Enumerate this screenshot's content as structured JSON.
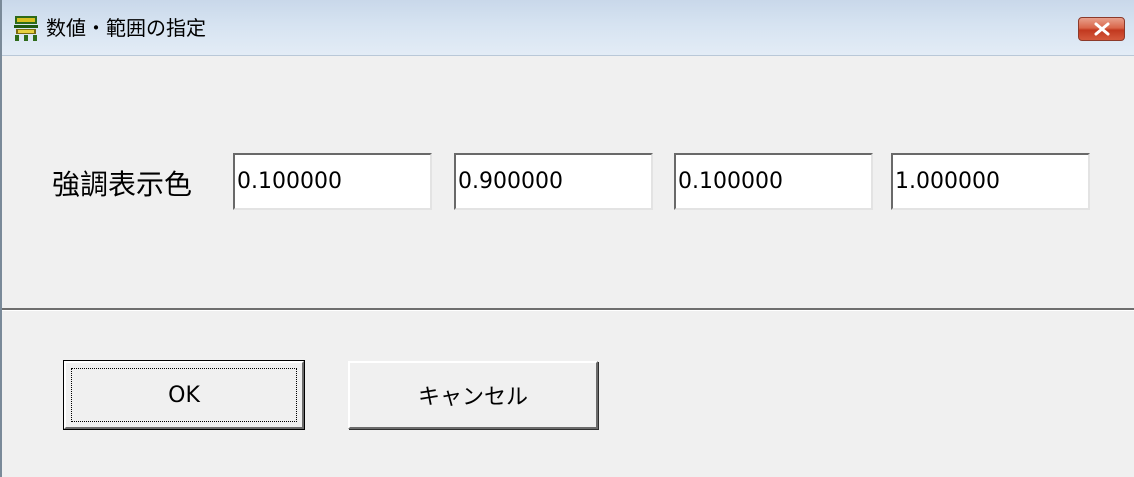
{
  "window": {
    "title": "数値・範囲の指定",
    "app_icon": "landscape-app-icon",
    "close_icon": "close-icon"
  },
  "form": {
    "label": "強調表示色",
    "fields": [
      "0.100000",
      "0.900000",
      "0.100000",
      "1.000000"
    ]
  },
  "buttons": {
    "ok_label": "OK",
    "cancel_label": "キャンセル"
  },
  "colors": {
    "close_button": "#c2391f",
    "dialog_background": "#f0f0f0",
    "titlebar": "#d6e3f1"
  }
}
